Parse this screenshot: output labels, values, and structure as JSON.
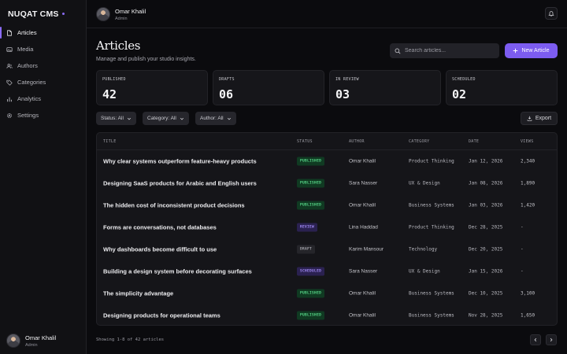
{
  "sidebar": {
    "brand": "NUQAT CMS",
    "items": [
      {
        "label": "Articles",
        "icon": "file-icon",
        "active": true
      },
      {
        "label": "Media",
        "icon": "image-icon"
      },
      {
        "label": "Authors",
        "icon": "users-icon"
      },
      {
        "label": "Categories",
        "icon": "tag-icon"
      },
      {
        "label": "Analytics",
        "icon": "bar-chart-icon"
      },
      {
        "label": "Settings",
        "icon": "gear-icon"
      }
    ],
    "user": {
      "name": "Omar Khalil",
      "role": "Admin"
    }
  },
  "topbar": {
    "user": {
      "name": "Omar Khalil",
      "role": "Admin"
    },
    "icon": "bell-icon"
  },
  "page": {
    "title": "Articles",
    "subtitle": "Manage and publish your studio insights."
  },
  "search": {
    "placeholder": "Search articles...",
    "value": ""
  },
  "new_button": "New Article",
  "stats": [
    {
      "label": "PUBLISHED",
      "value": "42"
    },
    {
      "label": "DRAFTS",
      "value": "06"
    },
    {
      "label": "IN REVIEW",
      "value": "03"
    },
    {
      "label": "SCHEDULED",
      "value": "02"
    }
  ],
  "filters": [
    {
      "label": "Status: All"
    },
    {
      "label": "Category: All"
    },
    {
      "label": "Author: All"
    }
  ],
  "export_label": "Export",
  "table": {
    "headers": {
      "title": "TITLE",
      "status": "STATUS",
      "author": "AUTHOR",
      "category": "CATEGORY",
      "date": "DATE",
      "views": "VIEWS"
    },
    "rows": [
      {
        "title": "Why clear systems outperform feature-heavy products",
        "status": "PUBLISHED",
        "author": "Omar Khalil",
        "category": "Product Thinking",
        "date": "Jan 12, 2026",
        "views": "2,340"
      },
      {
        "title": "Designing SaaS products for Arabic and English users",
        "status": "PUBLISHED",
        "author": "Sara Nasser",
        "category": "UX & Design",
        "date": "Jan 08, 2026",
        "views": "1,890"
      },
      {
        "title": "The hidden cost of inconsistent product decisions",
        "status": "PUBLISHED",
        "author": "Omar Khalil",
        "category": "Business Systems",
        "date": "Jan 03, 2026",
        "views": "1,420"
      },
      {
        "title": "Forms are conversations, not databases",
        "status": "REVIEW",
        "author": "Lina Haddad",
        "category": "Product Thinking",
        "date": "Dec 28, 2025",
        "views": "-"
      },
      {
        "title": "Why dashboards become difficult to use",
        "status": "DRAFT",
        "author": "Karim Mansour",
        "category": "Technology",
        "date": "Dec 20, 2025",
        "views": "-"
      },
      {
        "title": "Building a design system before decorating surfaces",
        "status": "SCHEDULED",
        "author": "Sara Nasser",
        "category": "UX & Design",
        "date": "Jan 15, 2026",
        "views": "-"
      },
      {
        "title": "The simplicity advantage",
        "status": "PUBLISHED",
        "author": "Omar Khalil",
        "category": "Business Systems",
        "date": "Dec 10, 2025",
        "views": "3,100"
      },
      {
        "title": "Designing products for operational teams",
        "status": "PUBLISHED",
        "author": "Omar Khalil",
        "category": "Business Systems",
        "date": "Nov 28, 2025",
        "views": "1,650"
      }
    ]
  },
  "pagination": {
    "summary": "Showing 1-8 of 42 articles",
    "prev_icon": "chevron-left-icon",
    "next_icon": "chevron-right-icon"
  },
  "colors": {
    "accent": "#7c5cf0",
    "published": "#58d98a",
    "review": "#a48cf8"
  }
}
